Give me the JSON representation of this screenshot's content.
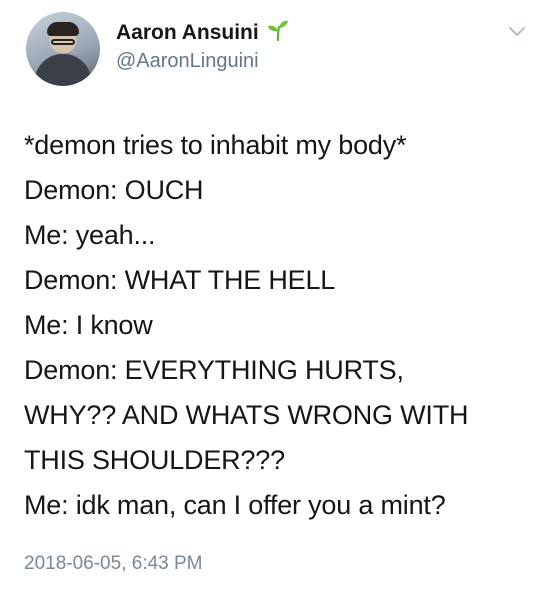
{
  "tweet": {
    "display_name": "Aaron Ansuini",
    "name_emoji_icon": "seedling-icon",
    "handle": "@AaronLinguini",
    "menu_icon": "chevron-down-icon",
    "lines": [
      "*demon tries to inhabit my body*",
      "Demon: OUCH",
      "Me: yeah...",
      "Demon: WHAT THE HELL",
      "Me: I know",
      "Demon: EVERYTHING HURTS,",
      "WHY?? AND WHATS WRONG WITH",
      "THIS SHOULDER???",
      "Me: idk man, can I offer you a mint?"
    ],
    "timestamp": "2018-06-05, 6:43 PM"
  },
  "colors": {
    "text": "#14171a",
    "secondary_text": "#657786",
    "emoji_green": "#5fb32f"
  }
}
